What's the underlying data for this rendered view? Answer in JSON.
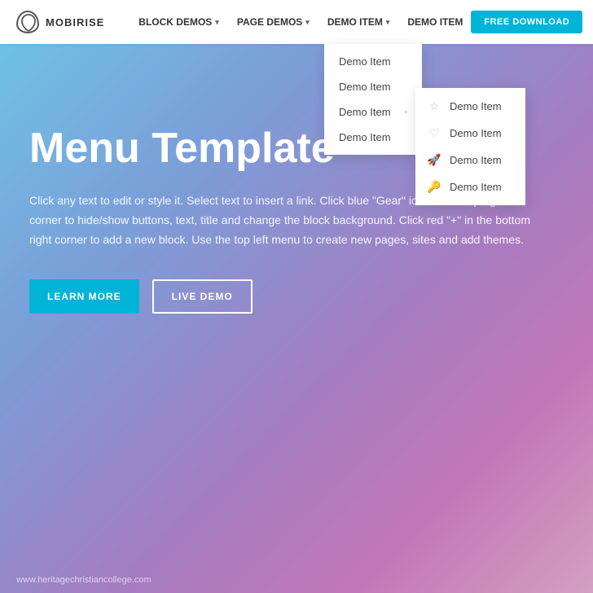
{
  "navbar": {
    "logo_text": "MOBIRISE",
    "nav_items": [
      {
        "label": "BLOCK DEMOS",
        "has_chevron": true
      },
      {
        "label": "PAGE DEMOS",
        "has_chevron": true
      },
      {
        "label": "DEMO ITEM",
        "has_chevron": true
      },
      {
        "label": "DEMO ITEM",
        "has_chevron": false
      }
    ],
    "free_download_label": "FREE DOWNLOAD"
  },
  "dropdown1": {
    "items": [
      {
        "label": "Demo Item",
        "has_arrow": false
      },
      {
        "label": "Demo Item",
        "has_arrow": false
      },
      {
        "label": "Demo Item",
        "has_arrow": true
      },
      {
        "label": "Demo Item",
        "has_arrow": false
      }
    ]
  },
  "dropdown2": {
    "items": [
      {
        "label": "Demo Item",
        "icon": "☆"
      },
      {
        "label": "Demo Item",
        "icon": "♡"
      },
      {
        "label": "Demo Item",
        "icon": "🚀"
      },
      {
        "label": "Demo Item",
        "icon": "🔑"
      }
    ]
  },
  "hero": {
    "title": "Menu Template",
    "description": "Click any text to edit or style it. Select text to insert a link. Click blue \"Gear\" icon in the top right corner to hide/show buttons, text, title and change the block background. Click red \"+\" in the bottom right corner to add a new block. Use the top left menu to create new pages, sites and add themes.",
    "btn_learn": "LEARN MORE",
    "btn_live": "LIVE DEMO"
  },
  "footer": {
    "watermark": "www.heritagechristiancollege.com"
  }
}
